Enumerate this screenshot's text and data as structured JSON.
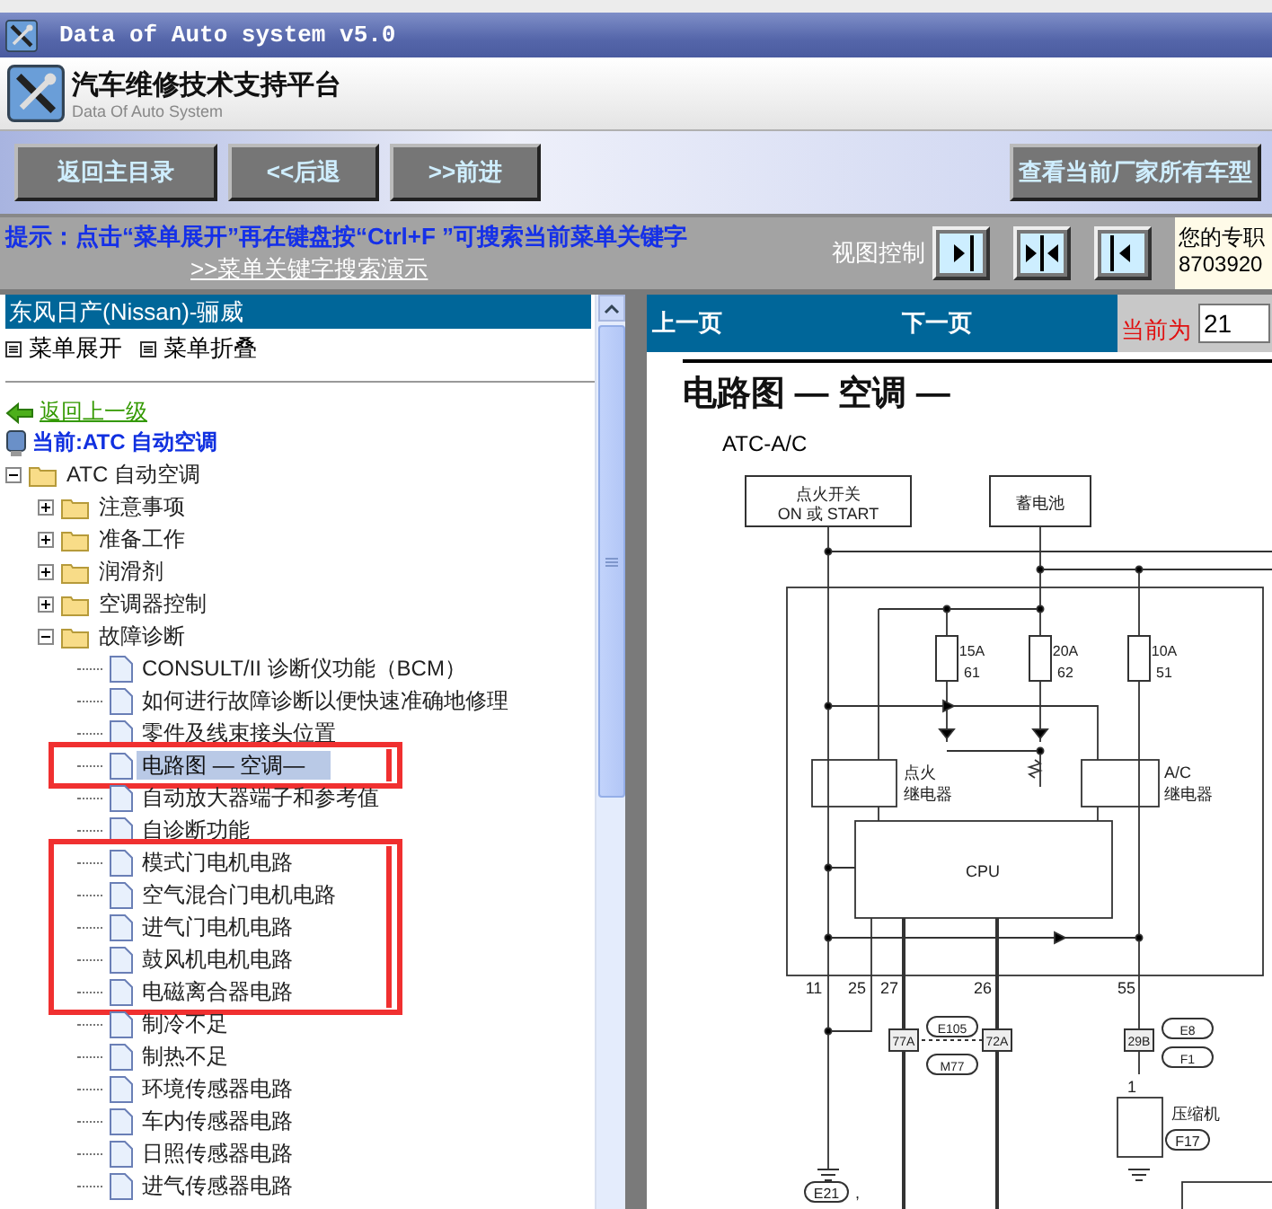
{
  "window": {
    "title": "Data of Auto system v5.0"
  },
  "header": {
    "title": "汽车维修技术支持平台",
    "subtitle": "Data Of Auto System"
  },
  "toolbar": {
    "buttons": [
      "返回主目录",
      "<<后退",
      ">>前进"
    ],
    "right_button": "查看当前厂家所有车型"
  },
  "hint_bar": {
    "hint": "提示：点击“菜单展开”再在键盘按“Ctrl+F ”可搜索当前菜单关键字",
    "demo_link": ">>菜单关键字搜索演示",
    "view_label": "视图控制",
    "notice": [
      "您的专职",
      "8703920"
    ]
  },
  "sidebar": {
    "title": "东风日产(Nissan)-骊威",
    "expand": "菜单展开",
    "collapse": "菜单折叠",
    "back": "返回上一级",
    "current": "当前:ATC 自动空调",
    "tree": [
      {
        "label": "ATC 自动空调",
        "kind": "folder",
        "expanded": true,
        "children": [
          {
            "label": "注意事项",
            "kind": "folder",
            "expanded": false
          },
          {
            "label": "准备工作",
            "kind": "folder",
            "expanded": false
          },
          {
            "label": "润滑剂",
            "kind": "folder",
            "expanded": false
          },
          {
            "label": "空调器控制",
            "kind": "folder",
            "expanded": false
          },
          {
            "label": "故障诊断",
            "kind": "folder",
            "expanded": true,
            "children": [
              {
                "label": "CONSULT/II 诊断仪功能（BCM）",
                "kind": "page",
                "selected": false,
                "marked": false
              },
              {
                "label": "如何进行故障诊断以便快速准确地修理",
                "kind": "page",
                "selected": false,
                "marked": false
              },
              {
                "label": "零件及线束接头位置",
                "kind": "page",
                "selected": false,
                "marked": false
              },
              {
                "label": "电路图 — 空调—",
                "kind": "page",
                "selected": true,
                "marked": true
              },
              {
                "label": "自动放大器端子和参考值",
                "kind": "page",
                "selected": false,
                "marked": false
              },
              {
                "label": "自诊断功能",
                "kind": "page",
                "selected": false,
                "marked": false
              },
              {
                "label": "模式门电机电路",
                "kind": "page",
                "selected": false,
                "marked": true
              },
              {
                "label": "空气混合门电机电路",
                "kind": "page",
                "selected": false,
                "marked": true
              },
              {
                "label": "进气门电机电路",
                "kind": "page",
                "selected": false,
                "marked": true
              },
              {
                "label": "鼓风机电机电路",
                "kind": "page",
                "selected": false,
                "marked": true
              },
              {
                "label": "电磁离合器电路",
                "kind": "page",
                "selected": false,
                "marked": true
              },
              {
                "label": "制冷不足",
                "kind": "page",
                "selected": false,
                "marked": false
              },
              {
                "label": "制热不足",
                "kind": "page",
                "selected": false,
                "marked": false
              },
              {
                "label": "环境传感器电路",
                "kind": "page",
                "selected": false,
                "marked": false
              },
              {
                "label": "车内传感器电路",
                "kind": "page",
                "selected": false,
                "marked": false
              },
              {
                "label": "日照传感器电路",
                "kind": "page",
                "selected": false,
                "marked": false
              },
              {
                "label": "进气传感器电路",
                "kind": "page",
                "selected": false,
                "marked": false
              }
            ]
          }
        ]
      }
    ]
  },
  "viewer": {
    "prev": "上一页",
    "next": "下一页",
    "page_label": "当前为",
    "page_value": "21",
    "document": {
      "title": "电路图 — 空调 —",
      "subtitle": "ATC-A/C",
      "diagram": {
        "ignition_switch": [
          "点火开关",
          "ON 或 START"
        ],
        "battery": "蓄电池",
        "fuses": [
          {
            "rating": "15A",
            "number": "61"
          },
          {
            "rating": "20A",
            "number": "62"
          },
          {
            "rating": "10A",
            "number": "51"
          }
        ],
        "ignition_relay": [
          "点火",
          "继电器"
        ],
        "ac_relay": [
          "A/C",
          "继电器"
        ],
        "cpu": "CPU",
        "pins": [
          "11",
          "25",
          "27",
          "26",
          "55"
        ],
        "connectors": [
          "77A",
          "72A",
          "29B"
        ],
        "tags": [
          "E105",
          "M77",
          "E8",
          "F1"
        ],
        "compressor": "压缩机",
        "compressor_pin": "1",
        "compressor_tag": "F17",
        "ground_tag": "E21",
        "ground_tag_suffix": ","
      }
    }
  }
}
